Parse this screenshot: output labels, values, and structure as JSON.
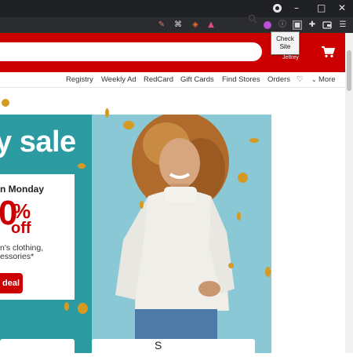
{
  "browser": {
    "window_controls": [
      "–",
      "□",
      "✕"
    ],
    "tooltip": "Check Site"
  },
  "header": {
    "user_name": "Jeffrey"
  },
  "nav": {
    "links": [
      "Registry",
      "Weekly Ad",
      "RedCard",
      "Gift Cards",
      "Find Stores",
      "Orders"
    ],
    "more_label": "More"
  },
  "hero": {
    "headline": "y sale",
    "promo_line1": "n Monday",
    "promo_number": "0",
    "promo_percent": "%",
    "promo_off": "off",
    "promo_desc_line1": "n's clothing,",
    "promo_desc_line2": "essories*",
    "deal_button": "deal"
  },
  "bottom_cards": [
    "",
    "S"
  ],
  "colors": {
    "brand_red": "#cc0000",
    "teal": "#2c9aa1",
    "light_teal": "#89c8d4",
    "chrome_dark": "#202124"
  },
  "icons": {
    "search": "search-icon",
    "cart": "cart-icon",
    "heart": "heart-icon"
  }
}
